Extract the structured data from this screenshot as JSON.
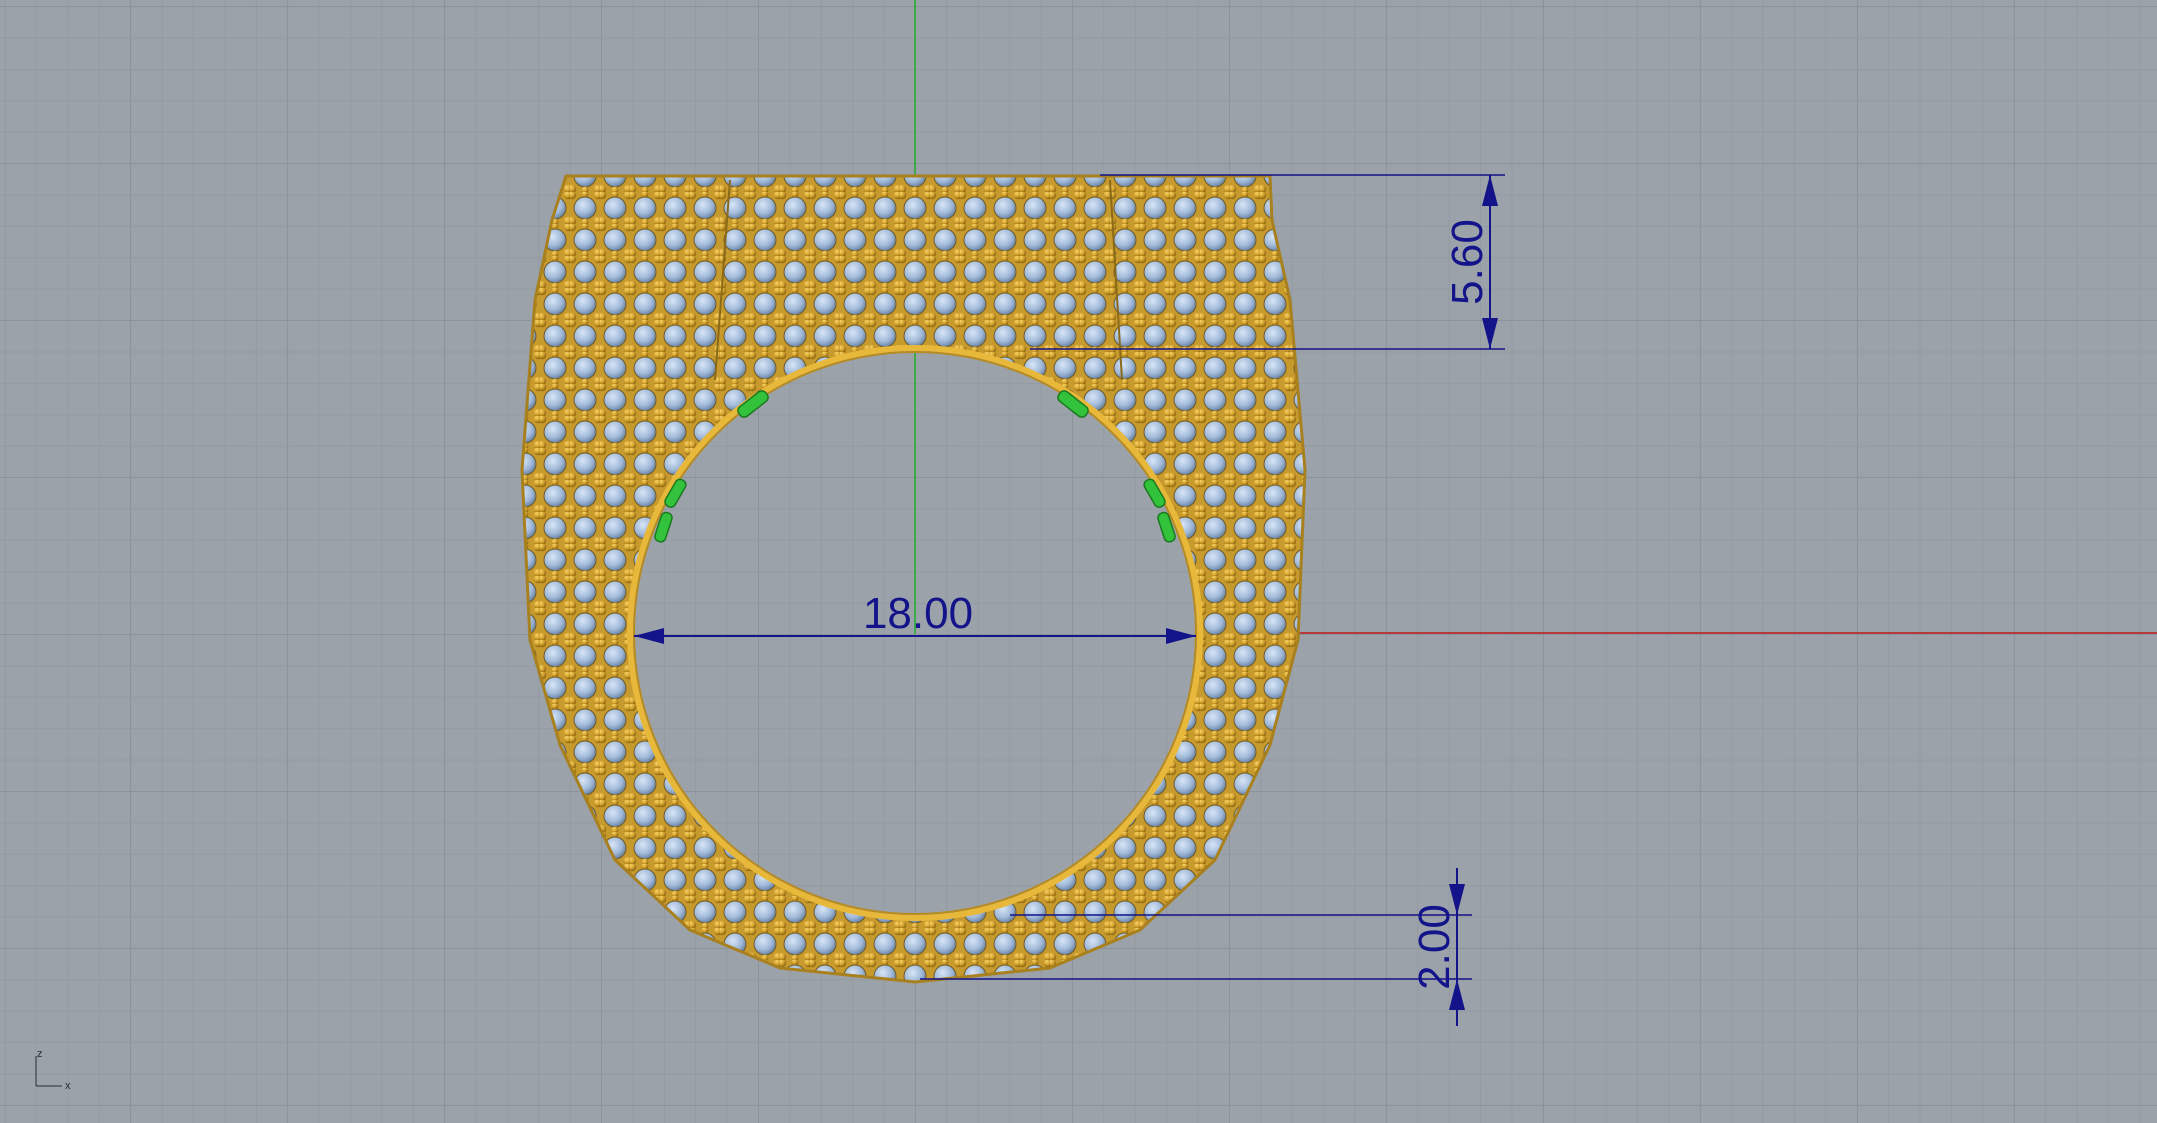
{
  "viewport": {
    "name": "Front",
    "background_color": "#9ba2aa",
    "grid_color": "#8a9199",
    "x_axis_color": "#c0151a",
    "z_axis_color": "#22b02a"
  },
  "model": {
    "metal_color": "#d4a22c",
    "stone_color": "#9fb8d8",
    "prong_highlight_color": "#33c23b"
  },
  "dimensions": {
    "inner_diameter": "18.00",
    "top_height": "5.60",
    "bottom_thickness": "2.00",
    "color": "#13138a"
  },
  "axis_indicator": {
    "vertical_label": "z",
    "horizontal_label": "x"
  }
}
